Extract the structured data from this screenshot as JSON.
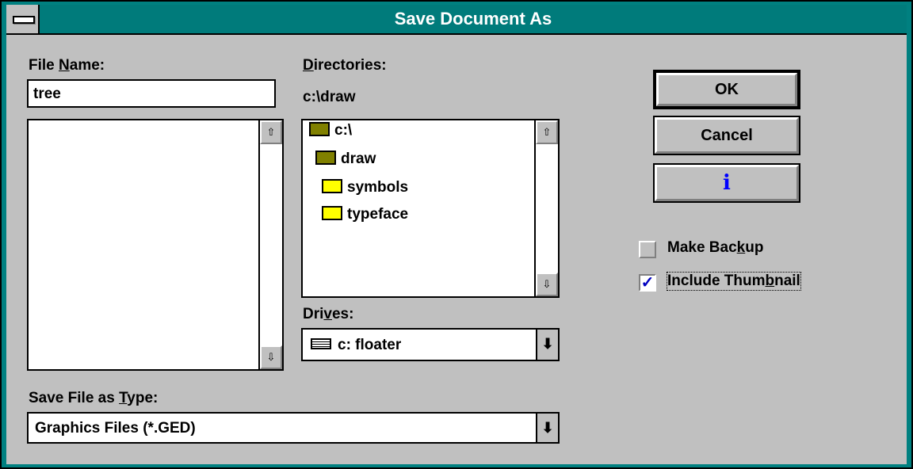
{
  "window": {
    "title": "Save Document As"
  },
  "file_name": {
    "label_pre": "File ",
    "label_mnemonic": "N",
    "label_post": "ame:",
    "value": "tree"
  },
  "directories": {
    "label_mnemonic": "D",
    "label_post": "irectories:",
    "current_path": "c:\\draw",
    "items": [
      {
        "label": "c:\\",
        "icon": "open-folder-icon"
      },
      {
        "label": "draw",
        "icon": "open-folder-icon"
      },
      {
        "label": "symbols",
        "icon": "folder-icon"
      },
      {
        "label": "typeface",
        "icon": "folder-icon"
      }
    ]
  },
  "drives": {
    "label_pre": "Dri",
    "label_mnemonic": "v",
    "label_post": "es:",
    "selected": "c: floater",
    "icon": "hard-drive-icon"
  },
  "save_type": {
    "label_pre": "Save File as ",
    "label_mnemonic": "T",
    "label_post": "ype:",
    "selected": "Graphics Files (*.GED)"
  },
  "buttons": {
    "ok": "OK",
    "cancel": "Cancel",
    "info_glyph": "i"
  },
  "options": {
    "make_backup": {
      "label_pre": "Make Bac",
      "label_mnemonic": "k",
      "label_post": "up",
      "checked": false
    },
    "include_thumbnail": {
      "label_pre": "Include Thum",
      "label_mnemonic": "b",
      "label_post": "nail",
      "checked": true,
      "check_glyph": "✓"
    }
  },
  "glyphs": {
    "scroll_up": "⇧",
    "scroll_down": "⇩",
    "dropdown": "⬇"
  },
  "colors": {
    "title_bar": "#007b7b",
    "dialog_bg": "#c0c0c0",
    "info_icon": "#0000ff",
    "check_mark": "#0000c0"
  }
}
